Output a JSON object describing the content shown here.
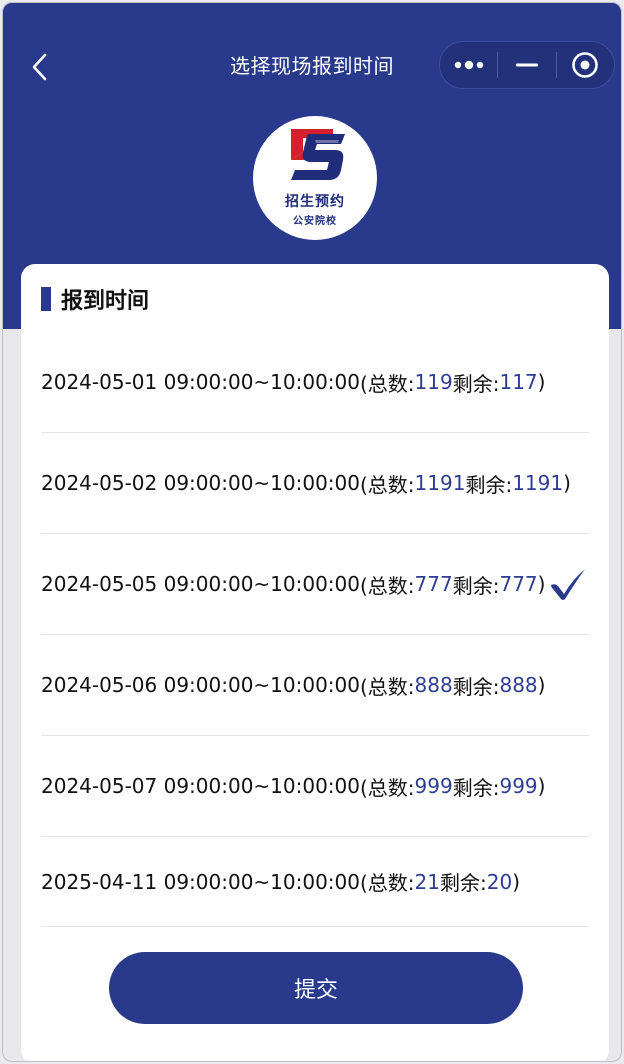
{
  "nav": {
    "title": "选择现场报到时间"
  },
  "logo": {
    "line1": "招生预约",
    "line2": "公安院校",
    "colors": {
      "red": "#d4202a",
      "blue": "#1f2d7a"
    }
  },
  "section": {
    "title": "报到时间"
  },
  "slots": [
    {
      "datetime": "2024-05-01 09:00:00~10:00:00",
      "total_label": "(总数:",
      "total": "119",
      "remain_label": "剩余:",
      "remain": "117",
      "close": ")",
      "selected": false
    },
    {
      "datetime": "2024-05-02 09:00:00~10:00:00",
      "total_label": "(总数:",
      "total": "1191",
      "remain_label": "剩余:",
      "remain": "1191",
      "close": ")",
      "selected": false
    },
    {
      "datetime": "2024-05-05 09:00:00~10:00:00",
      "total_label": "(总数:",
      "total": "777",
      "remain_label": "剩余:",
      "remain": "777",
      "close": ")",
      "selected": true
    },
    {
      "datetime": "2024-05-06 09:00:00~10:00:00",
      "total_label": "(总数:",
      "total": "888",
      "remain_label": "剩余:",
      "remain": "888",
      "close": ")",
      "selected": false
    },
    {
      "datetime": "2024-05-07 09:00:00~10:00:00",
      "total_label": "(总数:",
      "total": "999",
      "remain_label": "剩余:",
      "remain": "999",
      "close": ")",
      "selected": false
    },
    {
      "datetime": "2025-04-11 09:00:00~10:00:00",
      "total_label": "(总数:",
      "total": "21",
      "remain_label": "剩余:",
      "remain": "20",
      "close": ")",
      "selected": false
    }
  ],
  "submit_label": "提交",
  "colors": {
    "primary": "#293a8c",
    "number": "#2d3d94",
    "card": "#ffffff"
  }
}
